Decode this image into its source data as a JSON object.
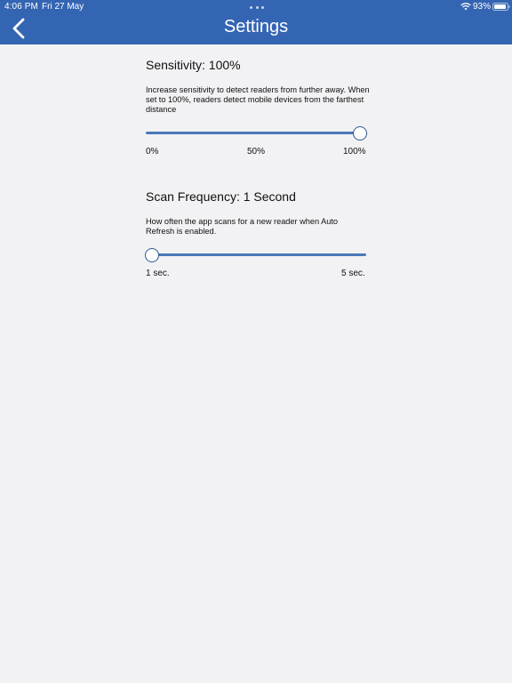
{
  "status_bar": {
    "time": "4:06 PM",
    "date": "Fri 27 May",
    "battery": "93%",
    "battery_level": 0.93
  },
  "header": {
    "title": "Settings",
    "back_icon": "chevron-left-icon"
  },
  "sensitivity": {
    "title": "Sensitivity: 100%",
    "description": "Increase sensitivity to detect readers from further away. When set to 100%, readers detect mobile devices from the farthest distance",
    "value_fraction": 1.0,
    "labels": [
      "0%",
      "50%",
      "100%"
    ]
  },
  "scan_frequency": {
    "title": "Scan Frequency:  1 Second",
    "description": "How often the app scans for a new reader when Auto Refresh is enabled.",
    "value_fraction": 0.0,
    "labels": [
      "1 sec.",
      "5 sec."
    ]
  },
  "colors": {
    "header": "#3465b3",
    "track": "#4a78b8",
    "background": "#f2f1f3"
  }
}
